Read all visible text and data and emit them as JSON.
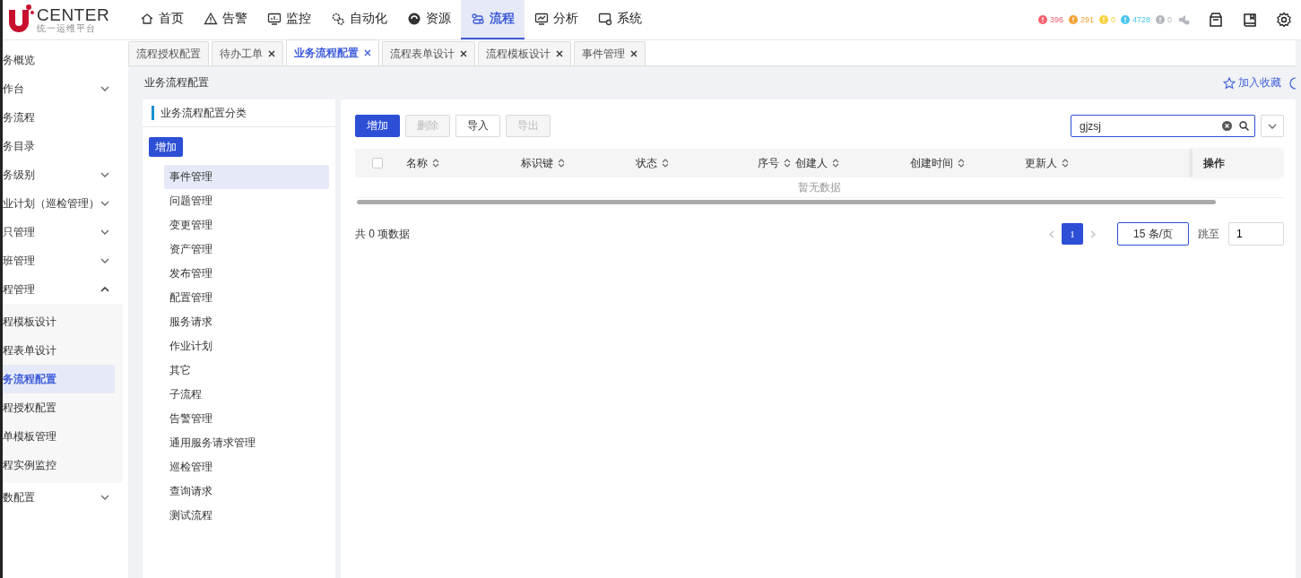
{
  "header": {
    "logo": {
      "name": "CENTER",
      "subtitle": "统一运维平台"
    },
    "nav": [
      {
        "label": "首页",
        "selected": false
      },
      {
        "label": "告警",
        "selected": false
      },
      {
        "label": "监控",
        "selected": false
      },
      {
        "label": "自动化",
        "selected": false
      },
      {
        "label": "资源",
        "selected": false
      },
      {
        "label": "流程",
        "selected": true
      },
      {
        "label": "分析",
        "selected": false
      },
      {
        "label": "系统",
        "selected": false
      }
    ],
    "alerts": [
      {
        "count": "396",
        "color": "#f5606e"
      },
      {
        "count": "291",
        "color": "#f7a035"
      },
      {
        "count": "0",
        "color": "#f7d23e"
      },
      {
        "count": "4728",
        "color": "#4cc7ef"
      },
      {
        "count": "0",
        "color": "#b5b8bf"
      }
    ]
  },
  "sidebar": {
    "items": [
      {
        "label": "务概览",
        "kind": "link",
        "selected": false
      },
      {
        "label": "作台",
        "kind": "group",
        "expanded": false,
        "selected": false
      },
      {
        "label": "务流程",
        "kind": "link",
        "selected": false
      },
      {
        "label": "务目录",
        "kind": "link",
        "selected": false
      },
      {
        "label": "务级别",
        "kind": "group",
        "expanded": false,
        "selected": false
      },
      {
        "label": "业计划（巡检管理）",
        "kind": "group",
        "expanded": false,
        "selected": false
      },
      {
        "label": "只管理",
        "kind": "group",
        "expanded": false,
        "selected": false
      },
      {
        "label": "班管理",
        "kind": "group",
        "expanded": false,
        "selected": false
      },
      {
        "label": "程管理",
        "kind": "group",
        "expanded": true,
        "selected": false,
        "children": [
          {
            "label": "程模板设计",
            "selected": false
          },
          {
            "label": "程表单设计",
            "selected": false
          },
          {
            "label": "务流程配置",
            "selected": true
          },
          {
            "label": "程授权配置",
            "selected": false
          },
          {
            "label": "单模板管理",
            "selected": false
          },
          {
            "label": "程实例监控",
            "selected": false
          }
        ]
      },
      {
        "label": "数配置",
        "kind": "group",
        "expanded": false,
        "selected": false
      }
    ]
  },
  "tabs": [
    {
      "label": "流程授权配置",
      "closable": false,
      "selected": false
    },
    {
      "label": "待办工单",
      "closable": true,
      "selected": false
    },
    {
      "label": "业务流程配置",
      "closable": true,
      "selected": true
    },
    {
      "label": "流程表单设计",
      "closable": true,
      "selected": false
    },
    {
      "label": "流程模板设计",
      "closable": true,
      "selected": false
    },
    {
      "label": "事件管理",
      "closable": true,
      "selected": false
    }
  ],
  "page": {
    "title": "业务流程配置",
    "favorite": "加入收藏"
  },
  "categories": {
    "title": "业务流程配置分类",
    "add_button": "增加",
    "items": [
      {
        "label": "事件管理",
        "selected": true
      },
      {
        "label": "问题管理",
        "selected": false
      },
      {
        "label": "变更管理",
        "selected": false
      },
      {
        "label": "资产管理",
        "selected": false
      },
      {
        "label": "发布管理",
        "selected": false
      },
      {
        "label": "配置管理",
        "selected": false
      },
      {
        "label": "服务请求",
        "selected": false
      },
      {
        "label": "作业计划",
        "selected": false
      },
      {
        "label": "其它",
        "selected": false
      },
      {
        "label": "子流程",
        "selected": false
      },
      {
        "label": "告警管理",
        "selected": false
      },
      {
        "label": "通用服务请求管理",
        "selected": false
      },
      {
        "label": "巡检管理",
        "selected": false
      },
      {
        "label": "查询请求",
        "selected": false
      },
      {
        "label": "测试流程",
        "selected": false
      }
    ]
  },
  "toolbar": {
    "buttons": [
      {
        "label": "增加",
        "kind": "primary",
        "disabled": false
      },
      {
        "label": "删除",
        "kind": "default",
        "disabled": true
      },
      {
        "label": "导入",
        "kind": "default",
        "disabled": false
      },
      {
        "label": "导出",
        "kind": "default",
        "disabled": true
      }
    ],
    "search": {
      "value": "gjzsj"
    }
  },
  "table": {
    "columns": [
      {
        "label": "名称"
      },
      {
        "label": "标识键"
      },
      {
        "label": "状态"
      },
      {
        "label": "序号"
      },
      {
        "label": "创建人"
      },
      {
        "label": "创建时间"
      },
      {
        "label": "更新人"
      }
    ],
    "select_all": {
      "checked": false
    },
    "action_column": "操作",
    "empty_text": "暂无数据"
  },
  "pagination": {
    "total": "共 0 项数据",
    "pages": [
      {
        "label": "1",
        "selected": true
      }
    ],
    "page_size": "15 条/页",
    "jump_label": "跳至",
    "jump_value": "1"
  }
}
